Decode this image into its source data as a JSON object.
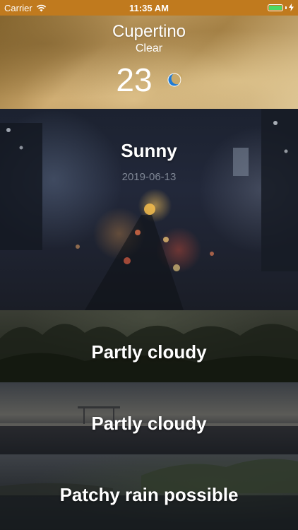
{
  "status_bar": {
    "carrier": "Carrier",
    "time": "11:35 AM",
    "battery_level": 1.0,
    "battery_color": "#4cd964",
    "icons": [
      "wifi-icon",
      "battery-icon",
      "charging-bolt-icon"
    ]
  },
  "current": {
    "city": "Cupertino",
    "condition": "Clear",
    "temperature": "23",
    "icon": "moon-icon"
  },
  "forecast": [
    {
      "condition": "Sunny",
      "date": "2019-06-13"
    },
    {
      "condition": "Partly cloudy"
    },
    {
      "condition": "Partly cloudy"
    },
    {
      "condition": "Patchy rain possible"
    }
  ],
  "colors": {
    "status_bar_bg": "#c07a1e",
    "date_text": "#7f8795",
    "moon": "#1e7bd6"
  }
}
